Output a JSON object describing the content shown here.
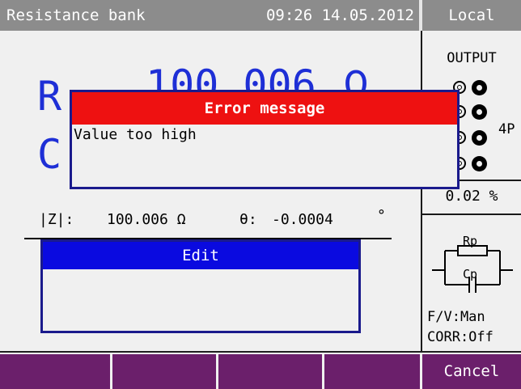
{
  "header": {
    "title": "Resistance bank",
    "clock": "09:26 14.05.2012",
    "mode": "Local"
  },
  "main": {
    "primary_partial": "R",
    "primary_value_partial": "100.006",
    "primary_unit_partial": "Ω",
    "secondary_partial": "C",
    "impedance_label": "|Z|:",
    "impedance_value": "100.006 Ω",
    "angle_label": "θ:",
    "angle_value": "-0.0004",
    "angle_unit": "°"
  },
  "side": {
    "output_label": "OUTPUT",
    "terminal_mode": "4P",
    "percent": "0.02 %",
    "circuit_top_label": "Rp",
    "circuit_bottom_label": "Cp",
    "fv_mode": "F/V:Man",
    "corr_mode": "CORR:Off"
  },
  "error_dialog": {
    "title": "Error message",
    "message": "Value too high"
  },
  "edit_dialog": {
    "title": "Edit",
    "value": ""
  },
  "softkeys": {
    "key1": "",
    "key2": "",
    "key3": "",
    "key4": "",
    "cancel": "Cancel"
  },
  "colors": {
    "header_bg": "#8c8c8c",
    "value_blue": "#1e2fd6",
    "error_red": "#ee1111",
    "edit_blue": "#0a0ae0",
    "softkey_purple": "#6b1f6b"
  }
}
